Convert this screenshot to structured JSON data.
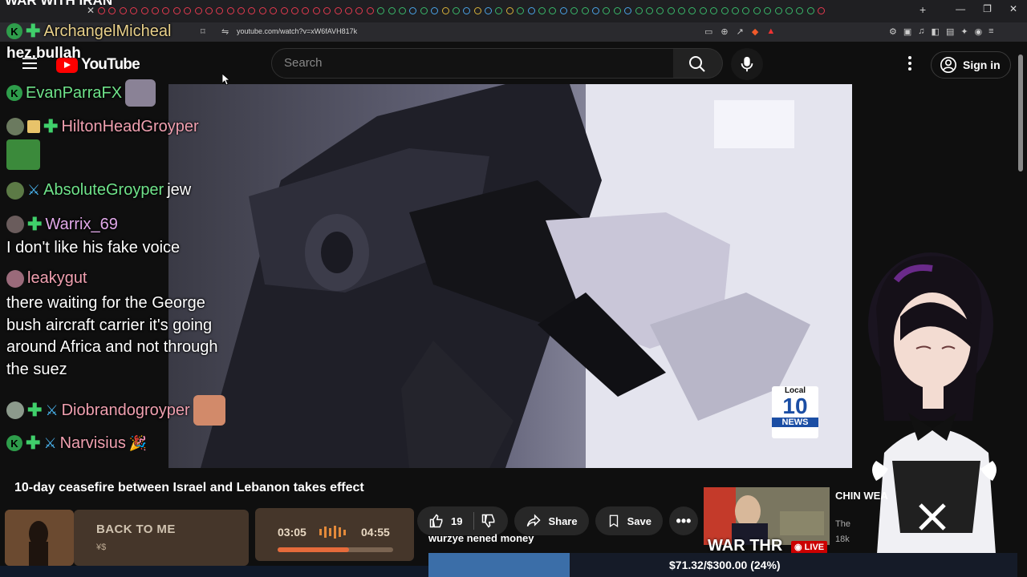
{
  "browser": {
    "tab_title": "WAR WITH IRAN",
    "url": "youtube.com/watch?v=xW6fAVH817k",
    "colors": {
      "tab_icon": "#e43a4f"
    }
  },
  "header": {
    "logo_text": "YouTube",
    "search_placeholder": "Search",
    "signin_label": "Sign in"
  },
  "stream": {
    "streamer_name": "hez.bullah"
  },
  "chat": {
    "messages": [
      {
        "user": "ArchangelMicheal",
        "user_color": "#e8d08a",
        "text": ""
      },
      {
        "user": "EvanParraFX",
        "user_color": "#6fe38a",
        "text": ""
      },
      {
        "user": "HiltonHeadGroyper",
        "user_color": "#f0a0b0",
        "text": ""
      },
      {
        "user": "AbsoluteGroyper",
        "user_color": "#6fe38a",
        "text": "jew"
      },
      {
        "user": "Warrix_69",
        "user_color": "#e0a8e8",
        "text": "I don't like his fake voice"
      },
      {
        "user": "leakygut",
        "user_color": "#f0a0b0",
        "text": "there waiting for the George bush aircraft carrier it's going around Africa and not through the suez"
      },
      {
        "user": "Diobrandogroyper",
        "user_color": "#f0a0b0",
        "text": ""
      },
      {
        "user": "Narvisius",
        "user_color": "#f0a0b0",
        "text": ""
      }
    ]
  },
  "video": {
    "title": "10-day ceasefire between Israel and Lebanon takes effect",
    "badge_local": "Local",
    "badge_number": "10",
    "badge_news": "NEWS",
    "like_count": "19",
    "share_label": "Share",
    "save_label": "Save",
    "caption": "wurzye nened money"
  },
  "music": {
    "song": "BACK TO ME",
    "artist": "¥$",
    "current_time": "03:05",
    "total_time": "04:55",
    "progress": 0.62
  },
  "recommendation": {
    "title": "CHIN WEA",
    "channel": "The",
    "views": "18k",
    "overlay_text": "WAR THR",
    "live_label": "LIVE"
  },
  "donation": {
    "text": "$71.32/$300.00 (24%)",
    "progress": 0.24,
    "color": "#3b6ea8"
  }
}
